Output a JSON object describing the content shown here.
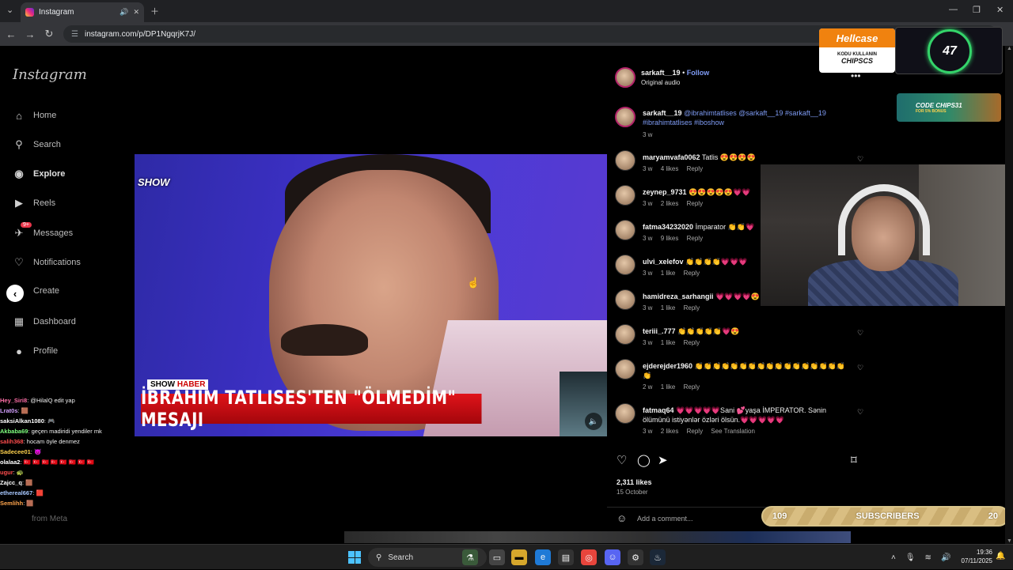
{
  "browser": {
    "tab_title": "Instagram",
    "url": "instagram.com/p/DP1NgqrjK7J/"
  },
  "sidebar": {
    "logo": "Instagram",
    "items": [
      {
        "label": "Home",
        "icon": "home-icon"
      },
      {
        "label": "Search",
        "icon": "search-icon"
      },
      {
        "label": "Explore",
        "icon": "compass-icon"
      },
      {
        "label": "Reels",
        "icon": "reels-icon"
      },
      {
        "label": "Messages",
        "icon": "messenger-icon",
        "badge": "9+"
      },
      {
        "label": "Notifications",
        "icon": "heart-icon"
      },
      {
        "label": "Create",
        "icon": "plus-icon"
      },
      {
        "label": "Dashboard",
        "icon": "dashboard-icon"
      },
      {
        "label": "Profile",
        "icon": "profile-icon"
      }
    ]
  },
  "video": {
    "channel_logo": "SHOW",
    "lower_tag_a": "SHOW",
    "lower_tag_b": "HABER",
    "headline": "İBRAHİM TATLISES'TEN \"ÖLMEDİM\" MESAJI"
  },
  "post": {
    "username": "sarkaft__19",
    "follow": "Follow",
    "audio": "Original audio",
    "caption_user": "sarkaft__19",
    "caption_tags": "@ibrahimtatlises @sarkaft__19 #sarkaft__19 #ibrahimtatlises #iboshow",
    "caption_time": "3 w",
    "likes": "2,311 likes",
    "date": "15 October",
    "add_comment": "Add a comment..."
  },
  "comments": [
    {
      "user": "maryamvafa0062",
      "text": "Tatlis 😍😍😍😍",
      "time": "3 w",
      "likes": "4 likes",
      "reply": "Reply"
    },
    {
      "user": "zeynep_9731",
      "text": "😍😍😍😍😍💗💗",
      "time": "3 w",
      "likes": "2 likes",
      "reply": "Reply"
    },
    {
      "user": "fatma34232020",
      "text": "İmparator 👏👏💗",
      "time": "3 w",
      "likes": "9 likes",
      "reply": "Reply"
    },
    {
      "user": "ulvi_xelefov",
      "text": "👏👏👏👏💗💗💗",
      "time": "3 w",
      "likes": "1 like",
      "reply": "Reply"
    },
    {
      "user": "hamidreza_sarhangii",
      "text": "💗💗💗💗😍",
      "time": "3 w",
      "likes": "1 like",
      "reply": "Reply"
    },
    {
      "user": "teriii_.777",
      "text": "👏👏👏👏👏💗😍",
      "time": "3 w",
      "likes": "1 like",
      "reply": "Reply"
    },
    {
      "user": "ejderejder1960",
      "text": "👏👏👏👏👏👏👏👏👏👏👏👏👏👏👏👏👏👏",
      "time": "2 w",
      "likes": "1 like",
      "reply": "Reply"
    },
    {
      "user": "fatmaq64",
      "text": "💗💗💗💗💗Sani 💕yaşa İMPERATOR. Sənin ölümünü istiyənlər özləri ölsün.💗💗💗💗💗",
      "time": "3 w",
      "likes": "2 likes",
      "reply": "Reply",
      "extra": "See Translation"
    }
  ],
  "overlays": {
    "hellcase_brand": "Hellcase",
    "hellcase_code_label": "KODU KULLANIN",
    "hellcase_code": "CHIPSCS",
    "counter": "47",
    "ad2_code": "CODE CHIPS31",
    "ad2_bonus": "FOR 5% BONUS",
    "subs_left": "109",
    "subs_label": "SUBSCRIBERS",
    "subs_right": "20",
    "meta_text": "from Meta"
  },
  "chat": [
    {
      "user": "Hey_Siri8",
      "msg": ": @HilalQ edit yap",
      "color": "#ff6fa8"
    },
    {
      "user": "Lrat0s",
      "msg": ": 🟫",
      "color": "#d4a0ff"
    },
    {
      "user": "saksiAlkan1080",
      "msg": ": 🎮",
      "color": "#ffffff"
    },
    {
      "user": "Akbaba69",
      "msg": ": geçen madiridi yendiler mk",
      "color": "#7fff7f"
    },
    {
      "user": "salih368",
      "msg": ": hocam öyle denmez",
      "color": "#ff4d4d"
    },
    {
      "user": "Sadecee01",
      "msg": ": 😈",
      "color": "#ffd24d"
    },
    {
      "user": "olalaa2",
      "msg": ": 🇹🇷 🇹🇷 🇹🇷 🇹🇷 🇹🇷 🇹🇷 🇹🇷 🇹🇷",
      "color": "#ffffff"
    },
    {
      "user": "ugur",
      "msg": ": 🐢",
      "color": "#ff4d4d"
    },
    {
      "user": "Zajcc_q",
      "msg": ": 🟫",
      "color": "#ffffff"
    },
    {
      "user": "ethereal667",
      "msg": ": 🟥",
      "color": "#a8c8ff"
    },
    {
      "user": "Semlihh",
      "msg": ": 🟫",
      "color": "#ffa54d"
    }
  ],
  "taskbar": {
    "search": "Search",
    "time": "19:36",
    "date": "07/11/2025"
  }
}
